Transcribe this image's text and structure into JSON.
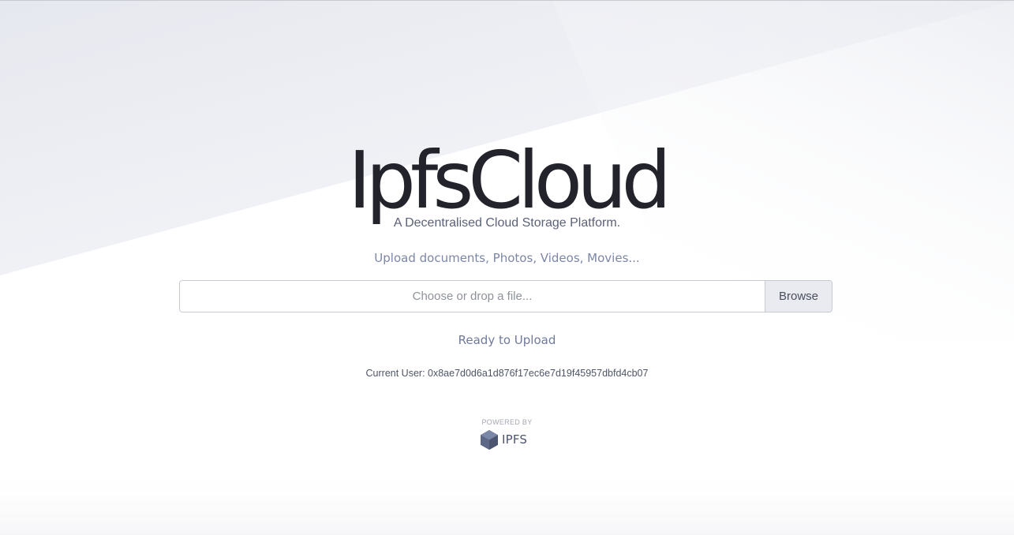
{
  "brand": {
    "title": "IpfsCloud",
    "tagline": "A Decentralised Cloud Storage Platform."
  },
  "upload": {
    "hint": "Upload documents, Photos, Videos, Movies...",
    "placeholder": "Choose or drop a file...",
    "browse_label": "Browse",
    "status": "Ready to Upload"
  },
  "user": {
    "label": "Current User: 0x8ae7d0d6a1d876f17ec6e7d19f45957dbfd4cb07"
  },
  "footer": {
    "powered_by": "POWERED BY",
    "ipfs_label": "IPFS",
    "ipfs_icon": "hexagon-cube-icon"
  },
  "colors": {
    "title": "#22232b",
    "accent_text": "#7c86a6",
    "background_shade": "#eceef4"
  }
}
